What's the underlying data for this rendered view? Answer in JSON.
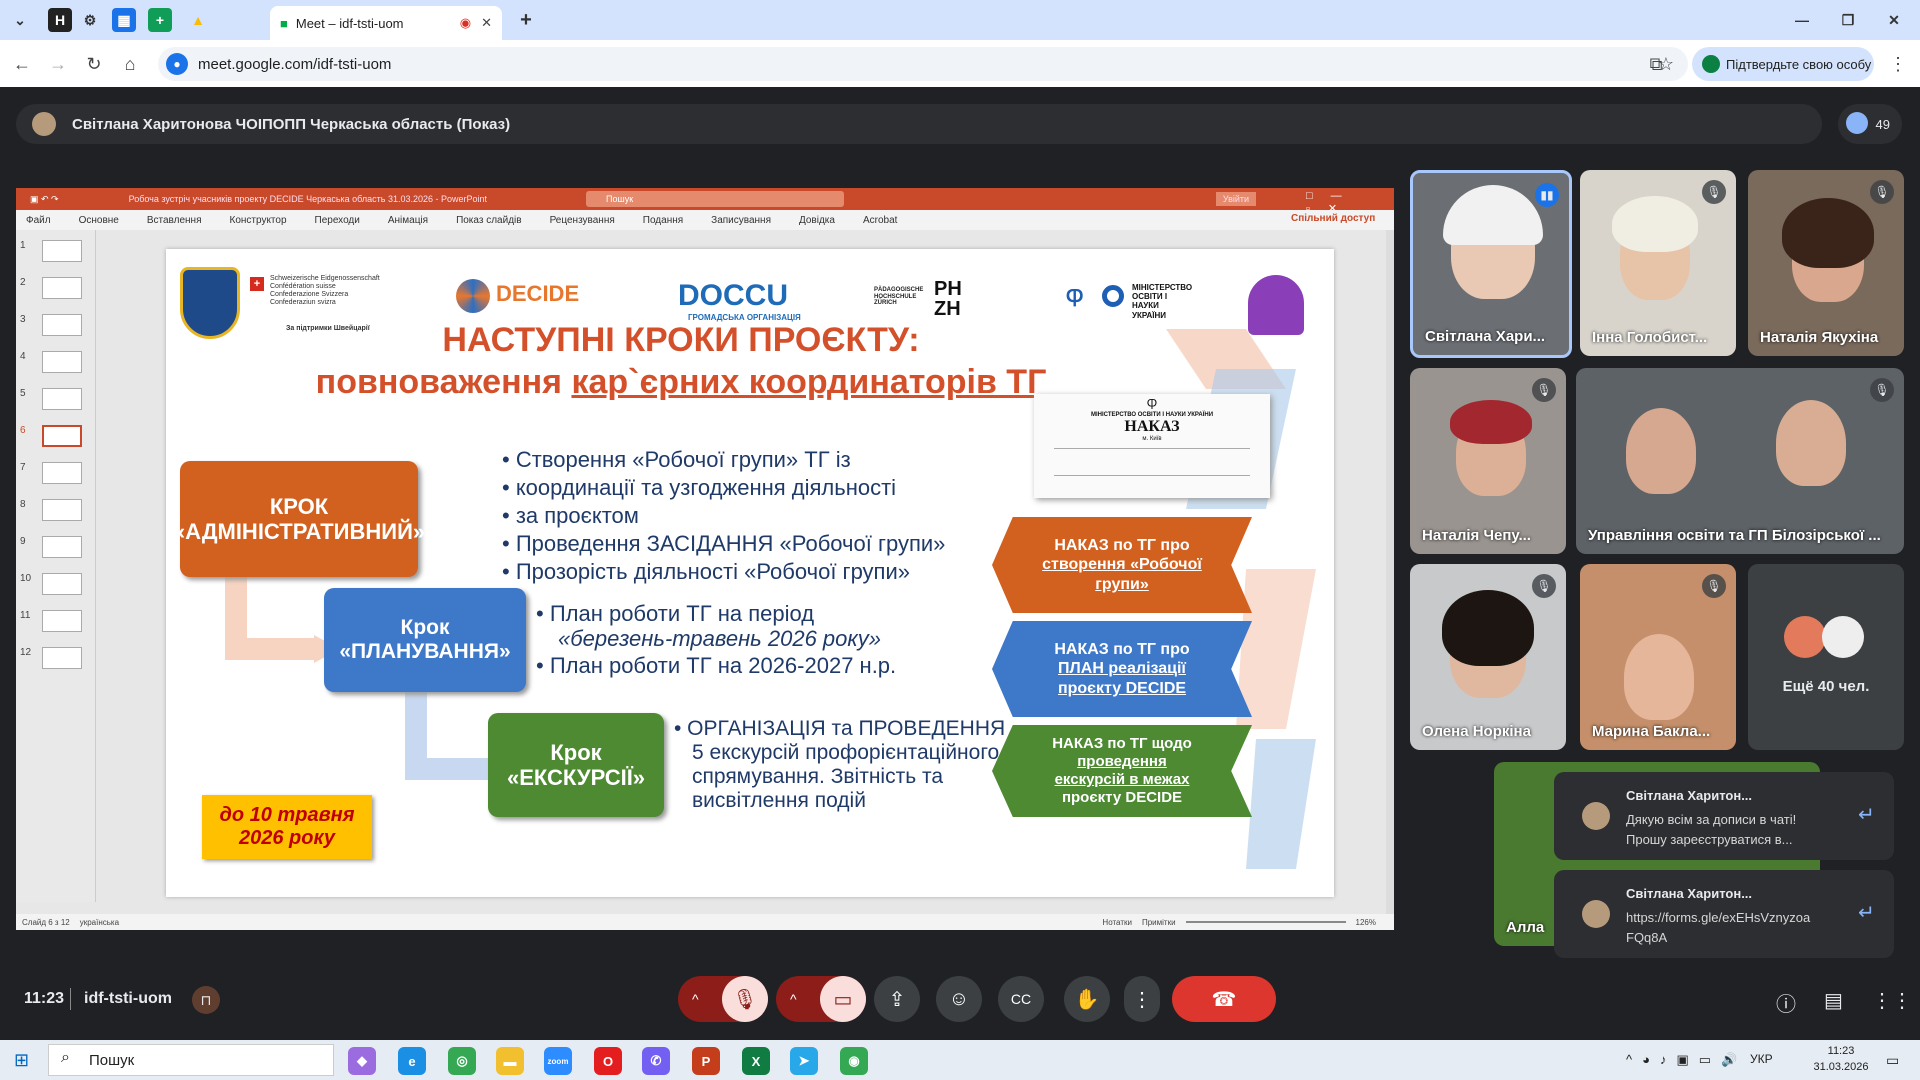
{
  "browser": {
    "tab_title": "Meet – idf-tsti-uom",
    "url": "meet.google.com/idf-tsti-uom",
    "profile_label": "Підтвердьте свою особу"
  },
  "banner": {
    "text": "Світлана Харитонова ЧОІПОПП Черкаська область (Показ)",
    "participant_count": "49"
  },
  "powerpoint": {
    "window_title": "Робоча зустріч учасників проекту DECIDE Черкаська область 31.03.2026  -  PowerPoint",
    "search": "Пошук",
    "signin": "Увійти",
    "share": "Спільний доступ",
    "menu": [
      "Файл",
      "Основне",
      "Вставлення",
      "Конструктор",
      "Переходи",
      "Анімація",
      "Показ слайдів",
      "Рецензування",
      "Подання",
      "Записування",
      "Довідка",
      "Acrobat"
    ],
    "thumbs": [
      "1",
      "2",
      "3",
      "4",
      "5",
      "6",
      "7",
      "8",
      "9",
      "10",
      "11",
      "12"
    ],
    "status_left": "Слайд 6 з 12",
    "status_lang": "українська",
    "status_notes": "Нотатки",
    "status_comments": "Примітки",
    "zoom": "126%"
  },
  "slide": {
    "swiss": [
      "Schweizerische Eidgenossenschaft",
      "Confédération suisse",
      "Confederazione Svizzera",
      "Confederaziun svizra"
    ],
    "swiss_support": "За підтримки Швейцарії",
    "decide": "DECIDE",
    "docu": "DOCCU",
    "docu_sub": "ГРОМАДСЬКА ОРГАНІЗАЦІЯ",
    "phzh": "PH ZH",
    "phzh_sub": "PÄDAGOGISCHE HOCHSCHULE ZÜRICH",
    "mon": "МІНІСТЕРСТВО ОСВІТИ І НАУКИ УКРАЇНИ",
    "title1": "НАСТУПНІ КРОКИ ПРОЄКТУ:",
    "title2a": "повноваження ",
    "title2b": "кар`єрних координаторів ТГ",
    "step1": [
      "КРОК",
      "«АДМІНІСТРАТИВНИЙ»"
    ],
    "step2": [
      "Крок",
      "«ПЛАНУВАННЯ»"
    ],
    "step3": [
      "Крок",
      "«ЕКСКУРСІЇ»"
    ],
    "bullets1": [
      "• Створення «Робочої групи» ТГ із",
      "• координації та узгодження діяльності",
      "• за проєктом",
      "• Проведення ЗАСІДАННЯ «Робочої групи»",
      "• Прозорість діяльності «Робочої групи»"
    ],
    "bullets2": [
      "• План роботи ТГ на період",
      "«березень-травень 2026 року»",
      "• План роботи ТГ на 2026-2027 н.р."
    ],
    "bullets3": [
      "• ОРГАНІЗАЦІЯ та ПРОВЕДЕННЯ",
      "5 екскурсій профорієнтаційного",
      "спрямування. Звітність та",
      "висвітлення подій"
    ],
    "doc": {
      "ministry": "МІНІСТЕРСТВО ОСВІТИ І НАУКИ УКРАЇНИ",
      "title": "НАКАЗ",
      "city": "м. Київ"
    },
    "tag1": [
      "НАКАЗ по ТГ про",
      "створення «Робочої",
      "групи»"
    ],
    "tag2": [
      "НАКАЗ по ТГ про",
      "ПЛАН реалізації",
      "проєкту DECIDE"
    ],
    "tag3": [
      "НАКАЗ по ТГ щодо",
      "проведення",
      "екскурсій  в межах",
      "проєкту DECIDE"
    ],
    "deadline": [
      "до 10 травня",
      "2026 року"
    ]
  },
  "tiles": [
    "Світлана Хари...",
    "Інна Голобист...",
    "Наталія Якухіна",
    "Наталія Чепу...",
    "Управління освіти та ГП Білозірської ...",
    "Олена Норкіна",
    "Марина Бакла...",
    "Ещё 40 чел.",
    "Алла"
  ],
  "chat": [
    {
      "name": "Світлана Харитон...",
      "text": [
        "Дякую всім за дописи в чаті!",
        "Прошу зареєструватися в..."
      ]
    },
    {
      "name": "Світлана Харитон...",
      "text": [
        "https://forms.gle/exEHsVznyzoa",
        "FQq8A"
      ]
    }
  ],
  "meeting": {
    "time": "11:23",
    "code": "idf-tsti-uom"
  },
  "taskbar": {
    "search": "Пошук",
    "lang": "УКР",
    "time": "11:23",
    "date": "31.03.2026"
  }
}
